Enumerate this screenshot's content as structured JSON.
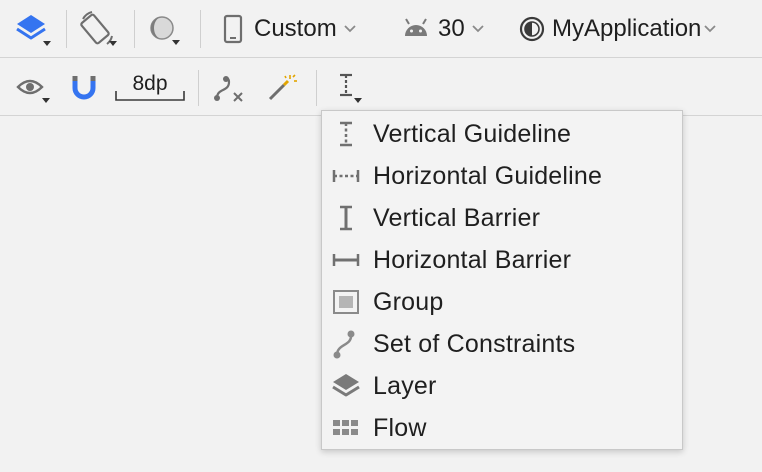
{
  "toolbar": {
    "device_label": "Custom",
    "api_label": "30",
    "theme_label": "MyApplication",
    "margin_label": "8dp"
  },
  "icons": {
    "layers": "layers-icon",
    "orientation": "rotate-device-icon",
    "night_mode": "night-mode-icon",
    "device": "phone-icon",
    "api": "android-icon",
    "theme": "theme-icon",
    "view_options": "eye-icon",
    "autoconnect": "magnet-icon",
    "clear_constraints": "clear-constraints-icon",
    "infer_constraints": "magic-wand-icon",
    "guidelines": "guidelines-icon"
  },
  "menu": {
    "items": [
      {
        "label": "Vertical Guideline",
        "icon": "vertical-guideline-icon"
      },
      {
        "label": "Horizontal Guideline",
        "icon": "horizontal-guideline-icon"
      },
      {
        "label": "Vertical Barrier",
        "icon": "vertical-barrier-icon"
      },
      {
        "label": "Horizontal Barrier",
        "icon": "horizontal-barrier-icon"
      },
      {
        "label": "Group",
        "icon": "group-icon"
      },
      {
        "label": "Set of Constraints",
        "icon": "constraint-set-icon"
      },
      {
        "label": "Layer",
        "icon": "layer-icon"
      },
      {
        "label": "Flow",
        "icon": "flow-icon"
      }
    ]
  },
  "colors": {
    "accent": "#3574f0",
    "icon_gray": "#6e6e6e",
    "android_gray": "#7a7a7a"
  }
}
